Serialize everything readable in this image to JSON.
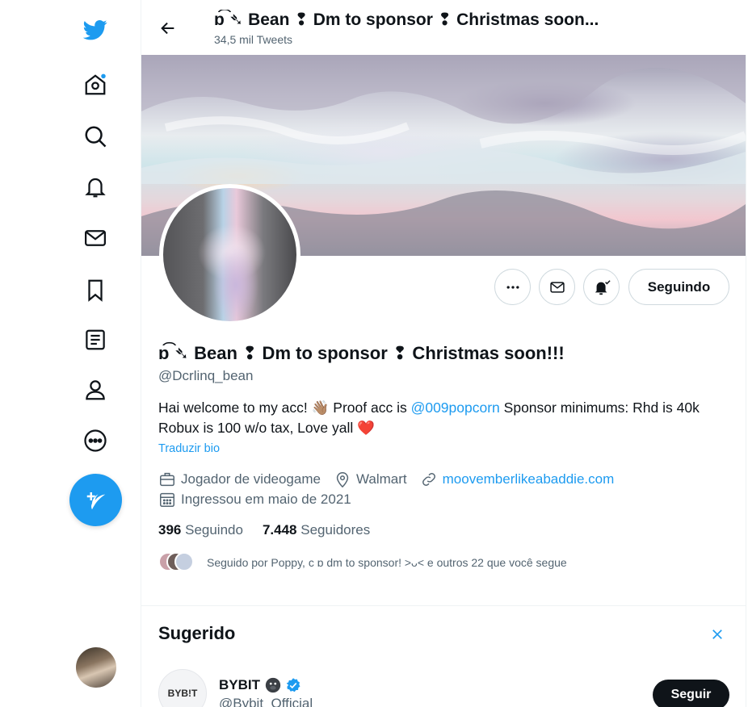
{
  "header": {
    "display_name": "ɒ͡ ➴ Bean ❢ Dm to sponsor ❢ Christmas soon...",
    "tweet_count": "34,5 mil Tweets"
  },
  "nav": {
    "icons": [
      "twitter-logo-icon",
      "home-icon",
      "explore-icon",
      "notifications-icon",
      "messages-icon",
      "bookmarks-icon",
      "lists-icon",
      "profile-icon",
      "more-icon",
      "compose-tweet-icon"
    ]
  },
  "profile": {
    "name": "ɒ͡ ➴ Bean ❢ Dm to sponsor ❢ Christmas soon!!!",
    "handle": "@Dcrlinq_bean",
    "bio_part1": "Hai welcome to my acc! 👋🏽 Proof acc is ",
    "bio_link": "@009popcorn",
    "bio_part2": " Sponsor minimums: Rhd is 40k Robux is 100 w/o tax, Love yall ❤️",
    "translate_label": "Traduzir bio",
    "category": "Jogador de videogame",
    "location": "Walmart",
    "website": "moovemberlikeabaddie.com",
    "joined": "Ingressou em maio de 2021",
    "following_count": "396",
    "following_label": "Seguindo",
    "followers_count": "7.448",
    "followers_label": "Seguidores",
    "followed_by": "Seguido por Poppy, c ɒ dm to sponsor! >ᴗ< e outros 22 que você segue",
    "following_button": "Seguindo"
  },
  "suggested": {
    "title": "Sugerido",
    "account": {
      "name": "BYBIT",
      "handle": "@Bybit_Official",
      "avatar_text": "BYB!T",
      "follow_label": "Seguir"
    }
  },
  "colors": {
    "accent": "#1d9bf0",
    "text": "#0f1419",
    "secondary": "#536471",
    "verified": "#1d9bf0"
  }
}
